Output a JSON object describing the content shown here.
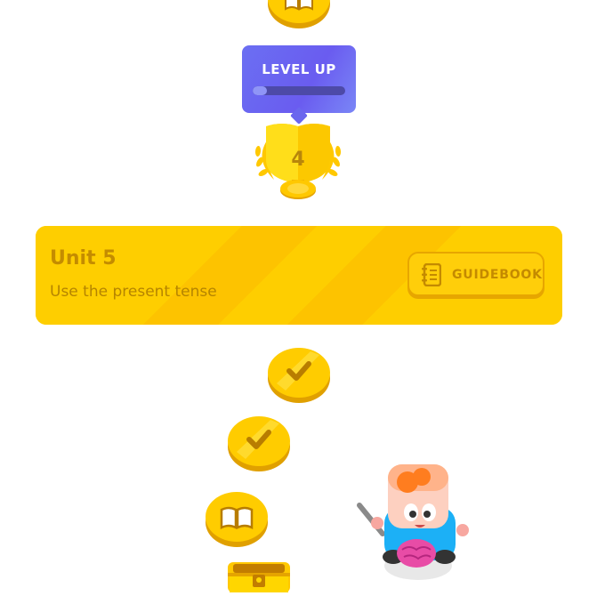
{
  "level_up": {
    "label": "LEVEL UP",
    "progress": 0.15
  },
  "trophy": {
    "number": "4"
  },
  "unit": {
    "title": "Unit 5",
    "subtitle": "Use the present tense",
    "guidebook_label": "GUIDEBOOK"
  },
  "path_nodes": [
    {
      "icon": "book-icon",
      "state": "completed"
    },
    {
      "icon": "trophy-icon",
      "state": "completed"
    },
    {
      "icon": "check-icon",
      "state": "completed"
    },
    {
      "icon": "check-icon",
      "state": "completed"
    },
    {
      "icon": "book-icon",
      "state": "current"
    },
    {
      "icon": "treasure-chest-icon",
      "state": "locked"
    }
  ],
  "colors": {
    "gold": "#ffc800",
    "gold_dark": "#e5a400",
    "unit_bg": "#ffcf00",
    "level_up_bg": "#6a66ee"
  }
}
